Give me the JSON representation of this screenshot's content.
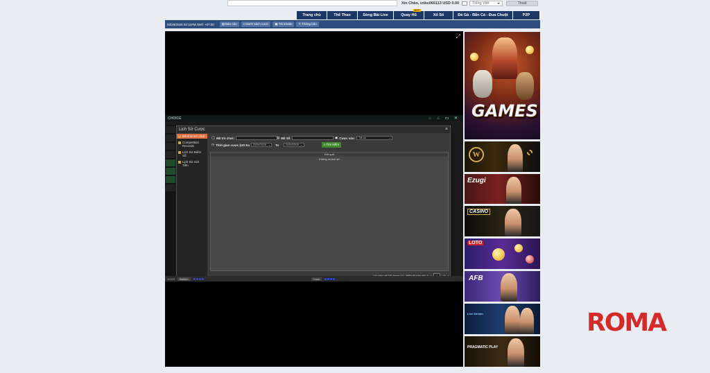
{
  "topbar": {
    "greeting": "Xin Chào, vnbs066113 USD 0.00",
    "language": "Tiếng Việt",
    "logout_label": "Thoát"
  },
  "main_nav": {
    "tabs": [
      {
        "label": "Trang chủ"
      },
      {
        "label": "Thể Thao"
      },
      {
        "label": "Sòng Bài Live"
      },
      {
        "label": "Quay Hũ",
        "badge": "HOT"
      },
      {
        "label": "Xổ Số"
      },
      {
        "label": "Đá Gà - Bắn Cá - Đua Chuột"
      },
      {
        "label": "P2P"
      }
    ]
  },
  "sub_bar": {
    "datetime": "03/28/2020 03:11PM GMT +07:00",
    "buttons": [
      {
        "label": "Báo cáo",
        "icon": "report-icon"
      },
      {
        "label": "Danh sách cược",
        "icon": "list-icon"
      },
      {
        "label": "Tài khoản",
        "icon": "account-icon"
      },
      {
        "label": "Thông báo",
        "icon": "announcement-icon"
      }
    ]
  },
  "game": {
    "header_title": "CHOICE",
    "footer": {
      "balance": "10423",
      "btn1": "Banker",
      "btn2": "Cuoc"
    },
    "bet_history_modal": {
      "title": "Lịch Sử Cược",
      "menu": [
        {
          "label": "Đã chơi trò chơi",
          "active": true
        },
        {
          "label": "Competition Records",
          "active": false
        },
        {
          "label": "Lịch Sử Điểm Số",
          "active": false
        },
        {
          "label": "Lịch Sử Gửi Tiền",
          "active": false
        }
      ],
      "filters": {
        "game_label": "Mã trò chơi:",
        "code_label": "Mã Số",
        "bet_label": "Cược vào:",
        "bet_value": "Tất cả",
        "time_label": "Thời gian cược (US Ea",
        "from_date": "2020/03/28",
        "to_label": "To",
        "to_date": "2020/03/28",
        "search_label": "Tìm kiếm"
      },
      "table_header": "Kết quả",
      "empty_text": "Không có lịch sử",
      "pager": {
        "summary": "Lưu bản ghi 0/0 trang 1/0",
        "size_label": "Hiển thị bản ghi: 0",
        "page": "1",
        "total": "/ 1"
      }
    }
  },
  "sidebar": {
    "banners": [
      {
        "title": "GAMES"
      },
      {
        "title": "W"
      },
      {
        "title": "Ezugi"
      },
      {
        "title": "CASINO"
      },
      {
        "title": "LOTO"
      },
      {
        "title": "AFB"
      },
      {
        "title": "Live Stream"
      },
      {
        "title": "PRAGMATIC PLAY"
      }
    ]
  },
  "watermark": "ROMA",
  "colors": {
    "nav_bg": "#1d3866",
    "sub_bar_bg": "#2d4d7c",
    "accent_orange": "#e06b3d",
    "search_green": "#3f8a2e",
    "watermark_red": "#d42a2a"
  }
}
